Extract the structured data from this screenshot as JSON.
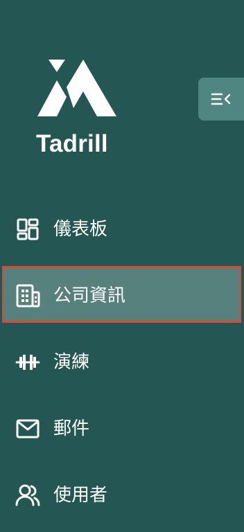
{
  "brand": {
    "name": "Tadrill",
    "logo_icon": "tadrill-logo-mark"
  },
  "collapse_button": {
    "icon": "collapse-menu-icon"
  },
  "nav": {
    "items": [
      {
        "label": "儀表板",
        "icon": "dashboard-grid-icon",
        "active": false
      },
      {
        "label": "公司資訊",
        "icon": "company-building-icon",
        "active": true
      },
      {
        "label": "演練",
        "icon": "dumbbell-icon",
        "active": false
      },
      {
        "label": "郵件",
        "icon": "mail-envelope-icon",
        "active": false
      },
      {
        "label": "使用者",
        "icon": "users-icon",
        "active": false
      }
    ]
  },
  "colors": {
    "sidebar_bg": "#245753",
    "collapse_button_bg": "#4f8682",
    "active_item_bg": "#56817d",
    "active_item_border": "#e4452f",
    "text": "#ffffff"
  }
}
